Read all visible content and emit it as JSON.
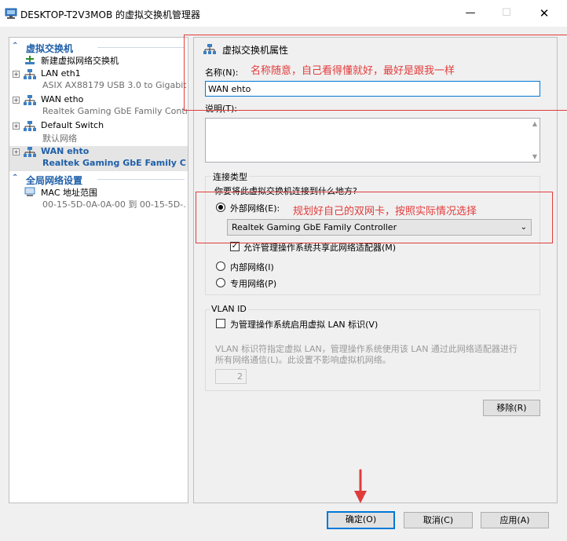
{
  "window": {
    "title": "DESKTOP-T2V3MOB 的虚拟交换机管理器",
    "minimize": "—",
    "maximize": "☐",
    "close": "✕"
  },
  "tree": {
    "section1_label": "虚拟交换机",
    "section2_label": "全局网络设置",
    "new_switch": "新建虚拟网络交换机",
    "lan": {
      "name": "LAN eth1",
      "sub": "ASIX AX88179 USB 3.0 to Gigabit ..."
    },
    "wan_etho": {
      "name": "WAN etho",
      "sub": "Realtek Gaming GbE Family Controller"
    },
    "default_switch": {
      "name": "Default Switch",
      "sub": "默认网络"
    },
    "wan_ehto": {
      "name": "WAN ehto",
      "sub": "Realtek Gaming GbE Family C..."
    },
    "mac": {
      "name": "MAC 地址范围",
      "sub": "00-15-5D-0A-0A-00 到 00-15-5D-..."
    },
    "expander": "+",
    "chevron": "⌃"
  },
  "props": {
    "header": "虚拟交换机属性",
    "name_label": "名称(N):",
    "name_value": "WAN ehto",
    "notes_label": "说明(T):",
    "conn_type_label": "连接类型",
    "conn_question": "你要将此虚拟交换机连接到什么地方?",
    "external_label": "外部网络(E):",
    "external_adapter": "Realtek Gaming GbE Family Controller",
    "allow_mgmt_label": "允许管理操作系统共享此网络适配器(M)",
    "internal_label": "内部网络(I)",
    "private_label": "专用网络(P)",
    "vlan_title": "VLAN ID",
    "vlan_enable_label": "为管理操作系统启用虚拟 LAN 标识(V)",
    "vlan_desc_1": "VLAN 标识符指定虚拟 LAN，管理操作系统使用该 LAN 通过此网络适配器进行",
    "vlan_desc_2": "所有网络通信(L)。此设置不影响虚拟机网络。",
    "vlan_value": "2",
    "remove_button": "移除(R)",
    "checkmark": "✓",
    "dropdown_arrow": "⌄"
  },
  "footer": {
    "ok": "确定(O)",
    "cancel": "取消(C)",
    "apply": "应用(A)"
  },
  "annotations": {
    "name_note": "名称随意，自己看得懂就好，最好是跟我一样",
    "adapter_note": "规划好自己的双网卡，按照实际情况选择",
    "color": "#e03c3c"
  },
  "colors": {
    "accent_blue": "#1f5fa8",
    "focus_blue": "#0078d7"
  }
}
